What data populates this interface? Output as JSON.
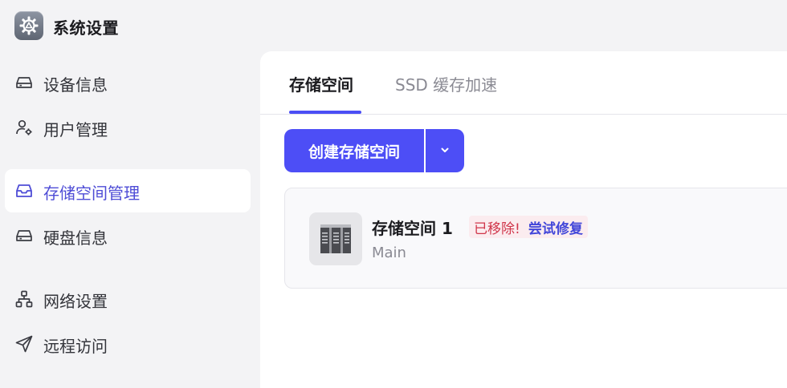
{
  "app": {
    "title": "系统设置",
    "logo_icon": "gear-icon"
  },
  "sidebar": {
    "items": [
      {
        "label": "设备信息",
        "icon": "drive-icon",
        "active": false
      },
      {
        "label": "用户管理",
        "icon": "user-gear-icon",
        "active": false
      },
      {
        "label": "存储空间管理",
        "icon": "inbox-icon",
        "active": true
      },
      {
        "label": "硬盘信息",
        "icon": "drive-icon",
        "active": false
      },
      {
        "label": "网络设置",
        "icon": "network-icon",
        "active": false
      },
      {
        "label": "远程访问",
        "icon": "send-icon",
        "active": false
      }
    ]
  },
  "main": {
    "tabs": [
      {
        "label": "存储空间",
        "active": true
      },
      {
        "label": "SSD 缓存加速",
        "active": false
      }
    ],
    "create_button": "创建存储空间",
    "storage": {
      "name": "存储空间 1",
      "sub": "Main",
      "status": "已移除!",
      "repair": "尝试修复"
    }
  },
  "colors": {
    "accent": "#4d4ef6",
    "active_nav_text": "#4e4cd6",
    "error": "#d0354a"
  }
}
